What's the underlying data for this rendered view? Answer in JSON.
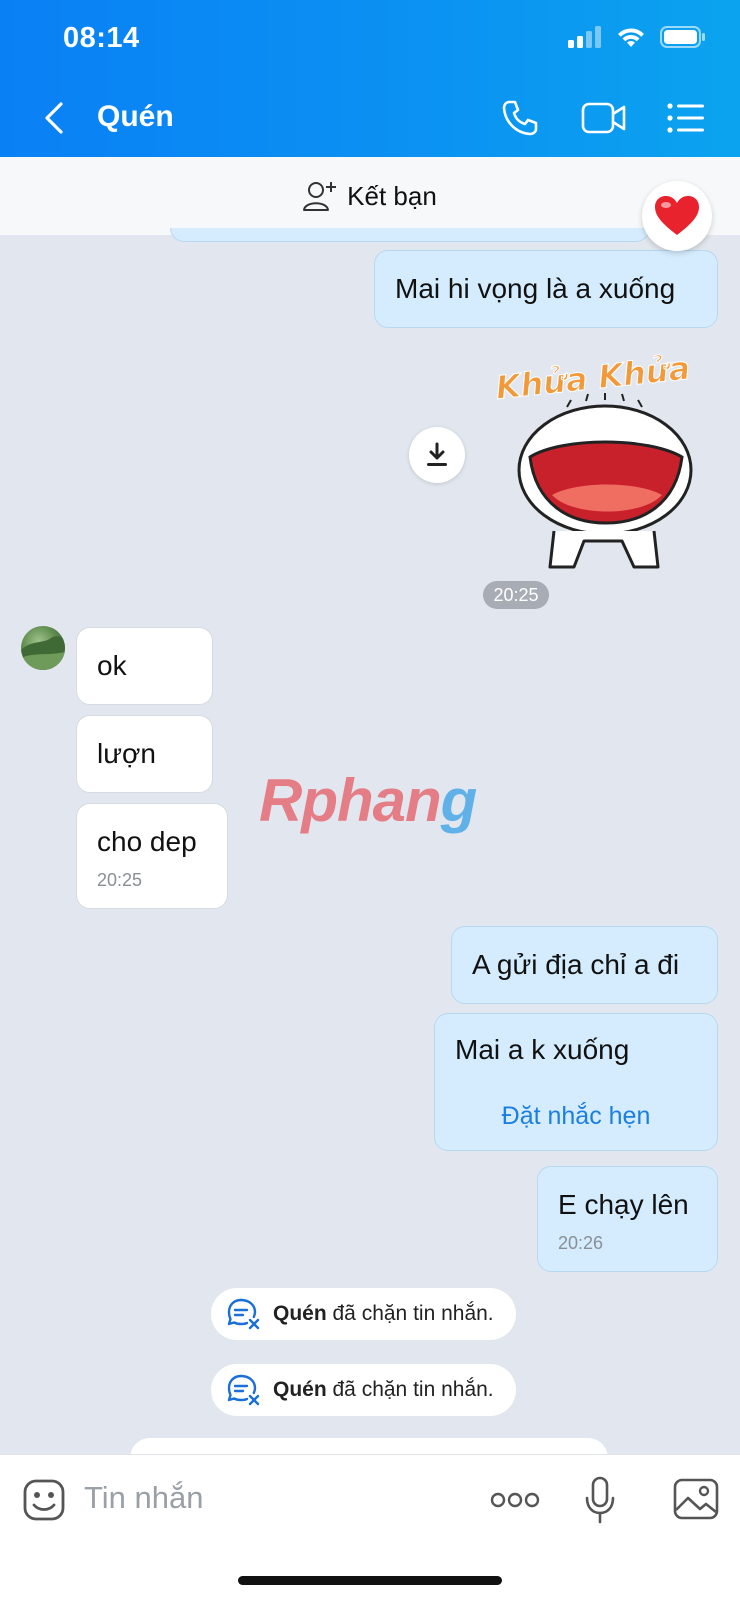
{
  "status": {
    "time": "08:14"
  },
  "header": {
    "contact_name": "Quén"
  },
  "friend_bar": {
    "label": "Kết bạn"
  },
  "messages": {
    "m1": "Mai hi vọng là a xuống",
    "sticker_time": "20:25",
    "r1": "ok",
    "r2": "lượn",
    "r3": "cho dep",
    "r3_time": "20:25",
    "s1": "A gửi địa chỉ a đi",
    "s2": "Mai a k xuống",
    "s2_action": "Đặt nhắc hẹn",
    "s3": "E chạy lên",
    "s3_time": "20:26"
  },
  "sticker": {
    "text": "Khửa Khửa"
  },
  "watermark": {
    "part1": "Rphan",
    "part2": "g"
  },
  "system": [
    {
      "name": "Quén",
      "text": " đã chặn tin nhắn."
    },
    {
      "name": "Quén",
      "text": " đã chặn tin nhắn."
    }
  ],
  "input": {
    "placeholder": "Tin nhắn"
  },
  "colors": {
    "header_start": "#0a80f5",
    "header_end": "#0ba3ef",
    "sent_bubble": "#d4ecfd",
    "link": "#1a7fe0"
  },
  "icons": [
    "back-icon",
    "phone-icon",
    "video-icon",
    "menu-list-icon",
    "add-friend-icon",
    "heart-icon",
    "download-icon",
    "emoji-icon",
    "more-icon",
    "mic-icon",
    "image-icon",
    "blocked-chat-icon"
  ]
}
